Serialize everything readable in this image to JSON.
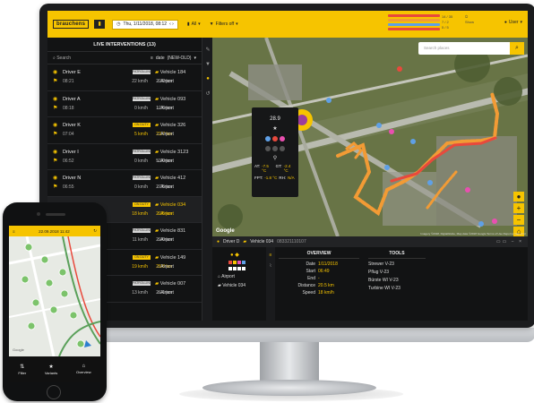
{
  "topbar": {
    "logo": "brauchens",
    "date": "Thu, 1/11/2018, 08:12",
    "date_nav": "‹ ›",
    "filter_all": "All",
    "filters_off": "Filters off",
    "user": "User",
    "bars": [
      "#e8493c",
      "#f29b35",
      "#5fa0e6",
      "#e8493c"
    ],
    "mini_stats": [
      "14 / 35",
      "7 / 2",
      "5 / 5"
    ],
    "mini_label": "Show"
  },
  "left_panel": {
    "title": "LIVE INTERVENTIONS",
    "count": "(13)",
    "search_placeholder": "Search",
    "sort_label": "date",
    "sort_order": "(NEW-OLD)",
    "rows": [
      {
        "driver": "Driver E",
        "time": "08:21",
        "distance": "22 km/h",
        "badge": "PATROLLING",
        "km": "20.2 km",
        "vehicle": "Vehicle 184",
        "place": "Airport",
        "hl": false
      },
      {
        "driver": "Driver A",
        "time": "08:18",
        "distance": "0 km/h",
        "badge": "PATROLLING",
        "km": "12.6 km",
        "vehicle": "Vehicle 093",
        "place": "Airport",
        "hl": false
      },
      {
        "driver": "Driver K",
        "time": "07:04",
        "distance": "5 km/h",
        "badge": "ON DUTY",
        "km": "23.7 km",
        "vehicle": "Vehicle 326",
        "place": "Airport",
        "hl": true
      },
      {
        "driver": "Driver I",
        "time": "06:52",
        "distance": "0 km/h",
        "badge": "PATROLLING",
        "km": "53.0 km",
        "vehicle": "Vehicle 3123",
        "place": "Airport",
        "hl": false
      },
      {
        "driver": "Driver N",
        "time": "06:55",
        "distance": "0 km/h",
        "badge": "PATROLLING",
        "km": "27.5 km",
        "vehicle": "Vehicle 412",
        "place": "Airport",
        "hl": false
      },
      {
        "driver": "Driver D",
        "time": "06:49",
        "distance": "18 km/h",
        "badge": "ON DUTY",
        "km": "20.5 km",
        "vehicle": "Vehicle 034",
        "place": "Airport",
        "hl": true,
        "sel": true
      },
      {
        "driver": "Driver H",
        "time": "06:40",
        "distance": "11 km/h",
        "badge": "PATROLLING",
        "km": "29.0 km",
        "vehicle": "Vehicle 831",
        "place": "Airport",
        "hl": false
      },
      {
        "driver": "Driver B",
        "time": "06:31",
        "distance": "19 km/h",
        "badge": "ON DUTY",
        "km": "28.8 km",
        "vehicle": "Vehicle 149",
        "place": "Airport",
        "hl": true
      },
      {
        "driver": "Driver C",
        "time": "06:22",
        "distance": "13 km/h",
        "badge": "PATROLLING",
        "km": "26.1 km",
        "vehicle": "Vehicle 007",
        "place": "Airport",
        "hl": false
      }
    ]
  },
  "map": {
    "search_placeholder": "Search places",
    "popup": {
      "value": "28.9",
      "at_label": "AT:",
      "at_value": "-7.5 °C",
      "gt_label": "GT:",
      "gt_value": "-2.4 °C",
      "fpt_label": "FPT:",
      "fpt_value": "-1.8 °C",
      "rh_label": "RH:",
      "rh_value": "N/A"
    },
    "google_label": "Google",
    "attribution": "Imagery ©2018, DigitalGlobe, Map data ©2018 Google Terms of Use Report a map error"
  },
  "bottom_panel": {
    "driver": "Driver D",
    "vehicle": "Vehicle 034",
    "vehicle_id": "083321110107",
    "place": "Airport",
    "vehicle_label": "Vehicle 034",
    "overview_title": "OVERVIEW",
    "overview": [
      {
        "k": "Date",
        "v": "1/11/2018"
      },
      {
        "k": "Start",
        "v": "06:49"
      },
      {
        "k": "End",
        "v": "-"
      },
      {
        "k": "Distance",
        "v": "20.5 km"
      },
      {
        "k": "Speed",
        "v": "18 km/h"
      }
    ],
    "tools_title": "TOOLS",
    "tools": [
      "Strewer V-23",
      "Pflug V-23",
      "Bürste WI V-23",
      "Turbine WI V-23"
    ]
  },
  "phone": {
    "date": "22.09.2018 11:42",
    "nav": [
      {
        "icon": "filter-icon",
        "label": "Filter"
      },
      {
        "icon": "star-icon",
        "label": "Variants"
      },
      {
        "icon": "home-icon",
        "label": "Overview"
      }
    ]
  }
}
